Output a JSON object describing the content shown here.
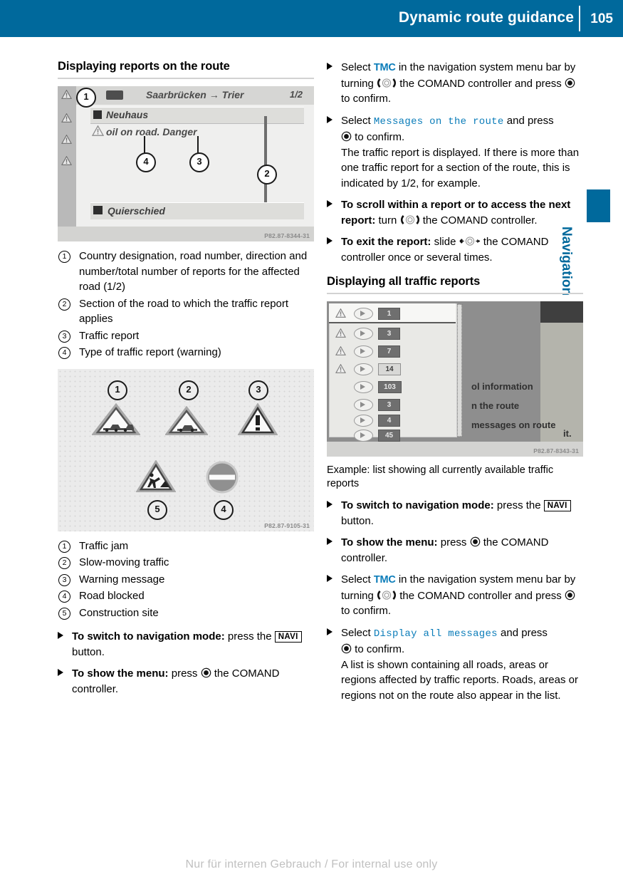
{
  "header": {
    "title": "Dynamic route guidance",
    "page_number": "105"
  },
  "side_tab": {
    "label": "Navigation",
    "accent_color": "#00699c"
  },
  "left_column": {
    "section_title": "Displaying reports on the route",
    "figure": {
      "name": "comand-traffic-report-screen",
      "header_text": "Saarbrücken → Trier",
      "header_count": "1/2",
      "selected_row": "Neuhaus",
      "message_row": "oil on road. Danger",
      "bottom_row": "Quierschied",
      "image_code": "P82.87-8344-31",
      "callouts": [
        "1",
        "2",
        "3",
        "4"
      ]
    },
    "legend": [
      {
        "num": "1",
        "text": "Country designation, road number, direction and number/total number of reports for the affected road (1/2)"
      },
      {
        "num": "2",
        "text": "Section of the road to which the traffic report applies"
      },
      {
        "num": "3",
        "text": "Traffic report"
      },
      {
        "num": "4",
        "text": "Type of traffic report (warning)"
      }
    ],
    "figure2": {
      "name": "traffic-symbols-chart",
      "image_code": "P82.87-9105-31",
      "callouts": [
        "1",
        "2",
        "3",
        "4",
        "5"
      ]
    },
    "legend2": [
      {
        "num": "1",
        "text": "Traffic jam"
      },
      {
        "num": "2",
        "text": "Slow-moving traffic"
      },
      {
        "num": "3",
        "text": "Warning message"
      },
      {
        "num": "4",
        "text": "Road blocked"
      },
      {
        "num": "5",
        "text": "Construction site"
      }
    ],
    "steps": [
      {
        "bold": "To switch to navigation mode:",
        "pre": " press the ",
        "keycap": "NAVI",
        "post": " button."
      },
      {
        "bold": "To show the menu:",
        "pre": " press ",
        "icon": "press-controller-icon",
        "post": " the COMAND controller."
      }
    ]
  },
  "right_column": {
    "steps_top": [
      {
        "parts": [
          {
            "t": "Select "
          },
          {
            "t": "TMC",
            "style": "blue"
          },
          {
            "t": " in the navigation system menu bar by turning "
          },
          {
            "t": "turn-controller-icon",
            "style": "icon-turn"
          },
          {
            "t": " the COMAND controller and press "
          },
          {
            "t": "press-controller-icon",
            "style": "icon-press"
          },
          {
            "t": " to confirm."
          }
        ]
      },
      {
        "parts": [
          {
            "t": "Select "
          },
          {
            "t": "Messages on the route",
            "style": "mono"
          },
          {
            "t": " and press "
          },
          {
            "t": "press-controller-icon",
            "style": "icon-press"
          },
          {
            "t": " to confirm."
          }
        ],
        "note": "The traffic report is displayed. If there is more than one traffic report for a section of the route, this is indicated by 1/2, for example."
      },
      {
        "parts": [
          {
            "t": "To scroll within a report or to access the next report:",
            "style": "bold"
          },
          {
            "t": " turn "
          },
          {
            "t": "turn-controller-icon",
            "style": "icon-turn"
          },
          {
            "t": " the COMAND controller."
          }
        ]
      },
      {
        "parts": [
          {
            "t": "To exit the report:",
            "style": "bold"
          },
          {
            "t": " slide "
          },
          {
            "t": "slide-controller-icon",
            "style": "icon-slide"
          },
          {
            "t": " the COMAND controller once or several times."
          }
        ]
      }
    ],
    "section_title": "Displaying all traffic reports",
    "figure": {
      "name": "all-traffic-reports-list",
      "image_code": "P82.87-8343-31",
      "badges": [
        "1",
        "3",
        "7",
        "14",
        "103",
        "3",
        "4",
        "45"
      ],
      "menu_lines": [
        "ol information",
        "n the route",
        "messages on route",
        "it."
      ]
    },
    "figure_caption": "Example: list showing all currently available traffic reports",
    "steps_bottom": [
      {
        "bold": "To switch to navigation mode:",
        "pre": " press the ",
        "keycap": "NAVI",
        "post": " button."
      },
      {
        "bold": "To show the menu:",
        "pre": " press ",
        "icon": "press-controller-icon",
        "post": " the COMAND controller."
      },
      {
        "parts": [
          {
            "t": "Select "
          },
          {
            "t": "TMC",
            "style": "blue"
          },
          {
            "t": " in the navigation system menu bar by turning "
          },
          {
            "t": "turn-controller-icon",
            "style": "icon-turn"
          },
          {
            "t": " the COMAND controller and press "
          },
          {
            "t": "press-controller-icon",
            "style": "icon-press"
          },
          {
            "t": " to confirm."
          }
        ]
      },
      {
        "parts": [
          {
            "t": "Select "
          },
          {
            "t": "Display all messages",
            "style": "mono"
          },
          {
            "t": " and press "
          },
          {
            "t": "press-controller-icon",
            "style": "icon-press"
          },
          {
            "t": " to confirm."
          }
        ],
        "note": "A list is shown containing all roads, areas or regions affected by traffic reports. Roads, areas or regions not on the route also appear in the list."
      }
    ]
  },
  "footer": {
    "text": "Nur für internen Gebrauch / For internal use only"
  },
  "text_fragments": {
    "select": "Select ",
    "tmc": "TMC",
    "in_nav_bar_by_turning": " in the navigation system menu bar by turning ",
    "the_comand_controller_and_press": " the COMAND controller and press ",
    "to_confirm": " to confirm.",
    "messages_on_the_route": "Messages on the route",
    "and_press": " and press ",
    "note_1": "The traffic report is displayed. If there is more than one traffic report for a section of the route, this is indicated by 1/2, for example.",
    "scroll_bold": "To scroll within a report or to access the next report:",
    "turn_word": " turn ",
    "the_comand_controller_period": " the COMAND controller.",
    "exit_bold": "To exit the report:",
    "slide_word": " slide ",
    "once_or_several": " the COMAND controller once or several times.",
    "switch_nav_bold": "To switch to navigation mode:",
    "press_the": " press the ",
    "navi": "NAVI",
    "button_period": " button.",
    "show_menu_bold": "To show the menu:",
    "press_word": " press ",
    "the_comand": " the COMAND controller.",
    "display_all_messages": "Display all messages",
    "note_2": "A list is shown containing all roads, areas or regions affected by traffic reports. Roads, areas or regions not on the route also appear in the list."
  }
}
